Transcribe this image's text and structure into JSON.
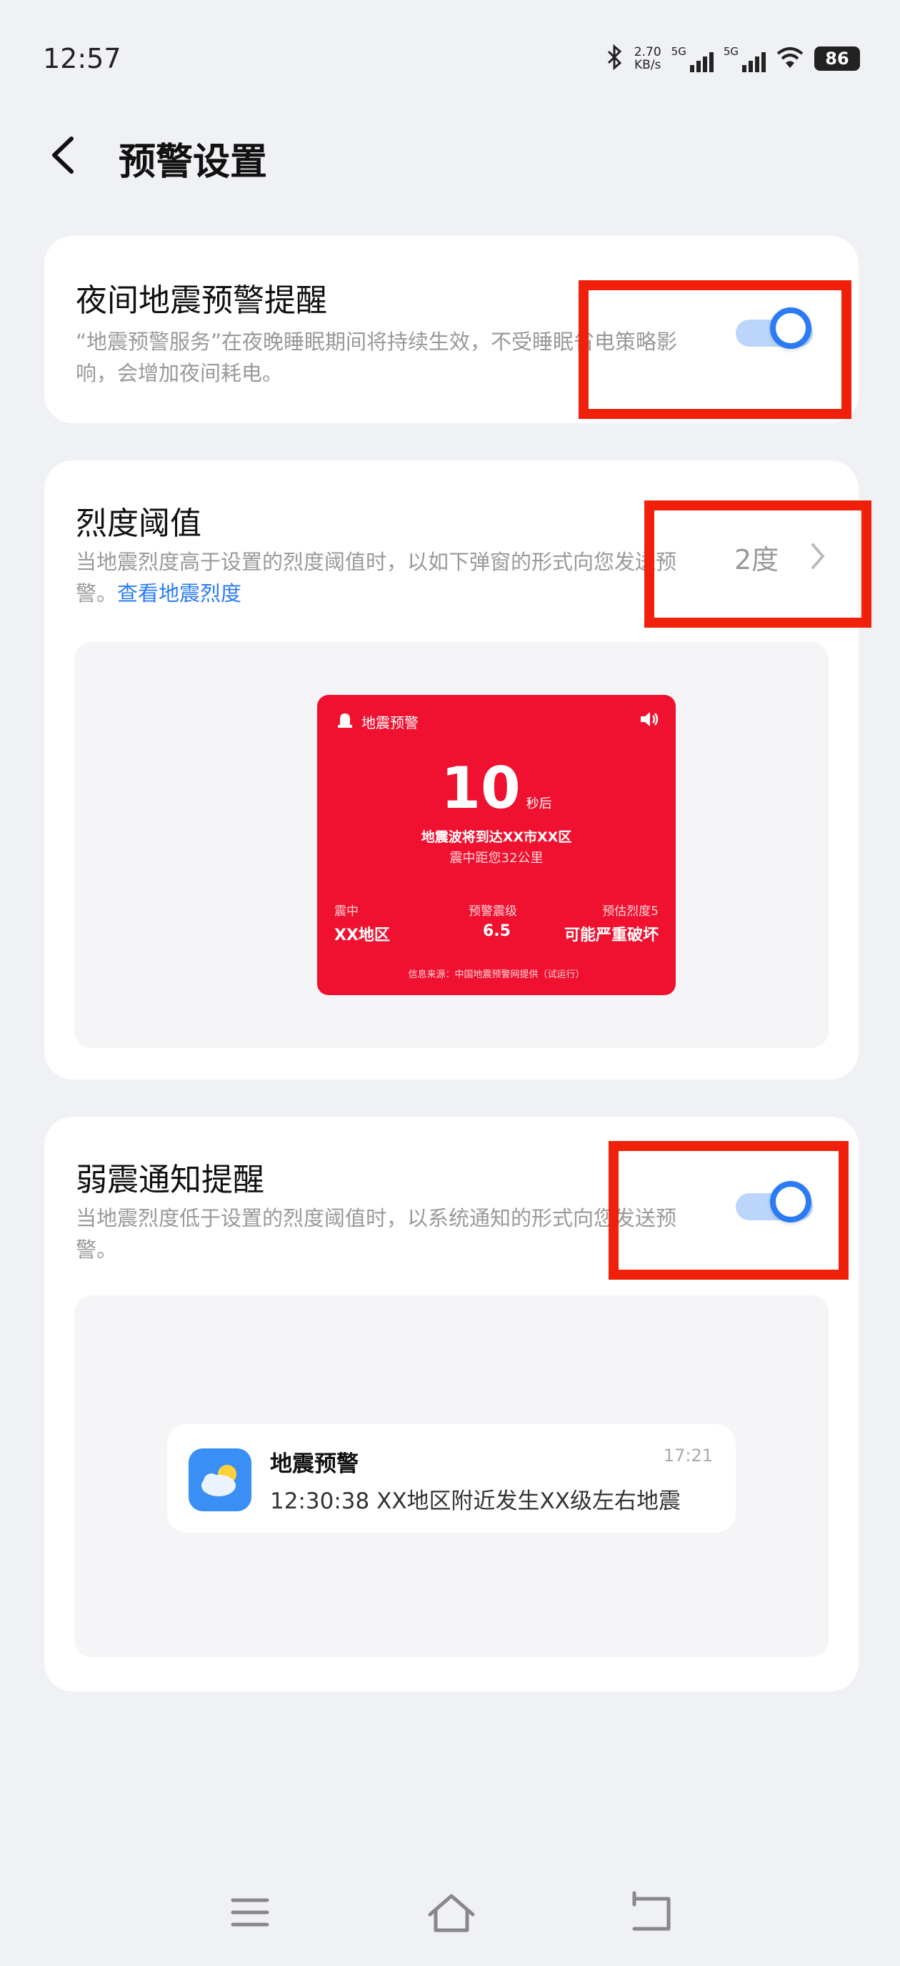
{
  "status_bar": {
    "time": "12:57",
    "net_speed_value": "2.70",
    "net_speed_unit": "KB/s",
    "sim1_label": "5G",
    "sim2_label": "5G",
    "battery": "86",
    "icons": [
      "bluetooth-icon",
      "signal-icon",
      "wifi-icon",
      "battery-icon"
    ]
  },
  "header": {
    "title": "预警设置",
    "back_icon": "back-arrow-icon"
  },
  "night_alert": {
    "title": "夜间地震预警提醒",
    "description": "“地震预警服务”在夜晚睡眠期间将持续生效，不受睡眠省电策略影响，会增加夜间耗电。",
    "enabled": true
  },
  "intensity_threshold": {
    "title": "烈度阈值",
    "description": "当地震烈度高于设置的烈度阈值时，以如下弹窗的形式向您发送预警。",
    "link": "查看地震烈度",
    "value": "2度",
    "preview": {
      "header": "地震预警",
      "countdown": "10",
      "countdown_unit": "秒后",
      "line1": "地震波将到达XX市XX区",
      "line2": "震中距您32公里",
      "epicenter_label": "震中",
      "epicenter_value": "XX地区",
      "magnitude_label": "预警震级",
      "magnitude_value": "6.5",
      "intensity_label": "预估烈度5",
      "intensity_value": "可能严重破坏",
      "source": "信息来源：中国地震预警网提供（试运行）"
    }
  },
  "weak_quake": {
    "title": "弱震通知提醒",
    "description": "当地震烈度低于设置的烈度阈值时，以系统通知的形式向您发送预警。",
    "enabled": true,
    "notification": {
      "app_name": "地震预警",
      "time": "17:21",
      "text": "12:30:38 XX地区附近发生XX级左右地震"
    }
  },
  "colors": {
    "accent": "#2a7bf4",
    "alert_red": "#f0102f",
    "highlight_box": "#f0200a",
    "background": "#f0f1f4"
  }
}
